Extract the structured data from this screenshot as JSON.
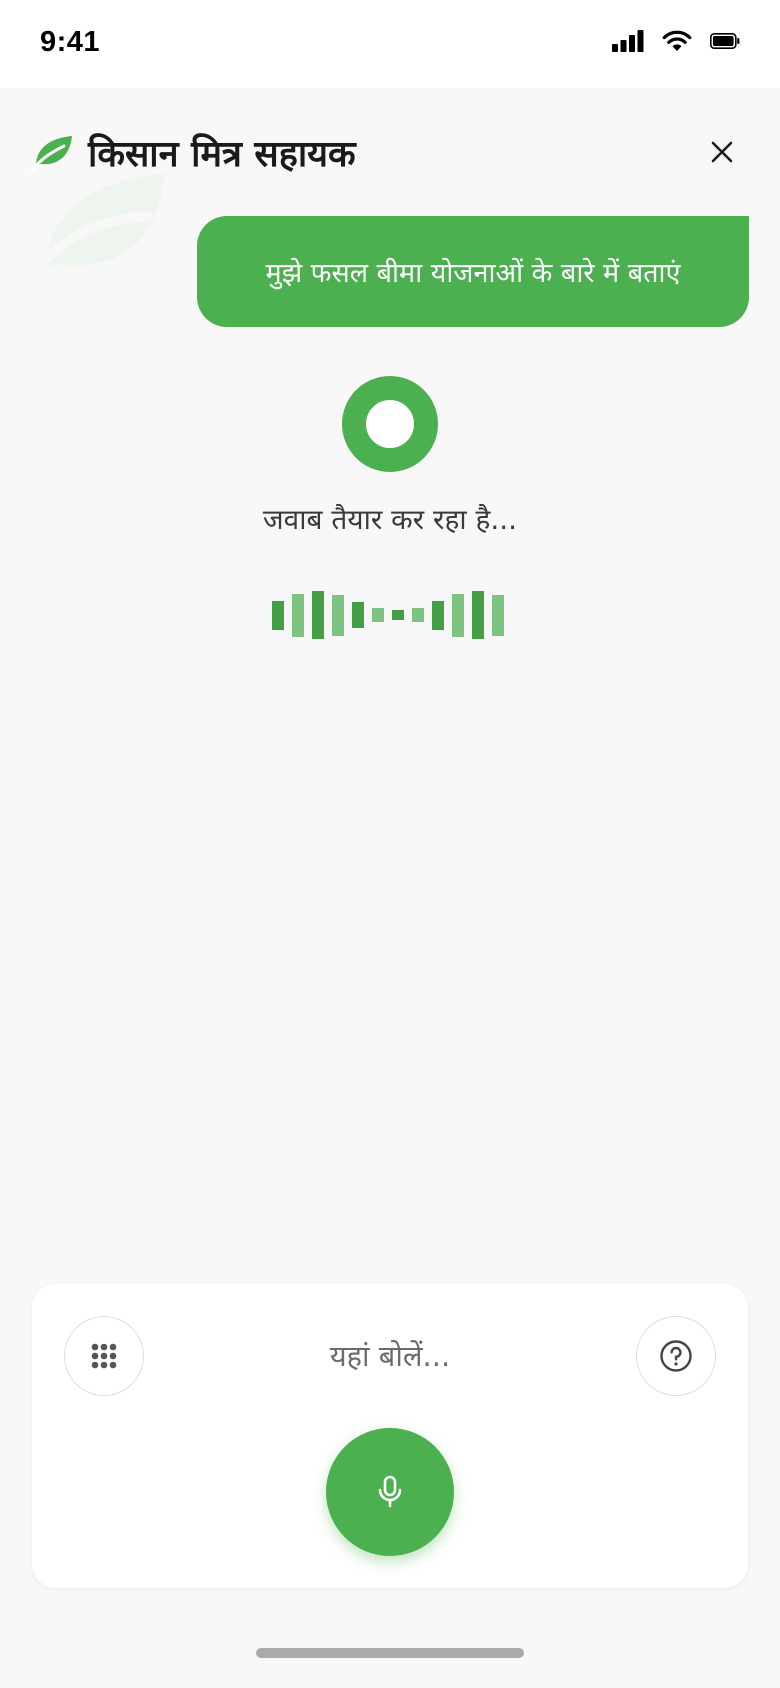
{
  "status_bar": {
    "time": "9:41",
    "icons": [
      "signal-icon",
      "wifi-icon",
      "battery-icon"
    ]
  },
  "header": {
    "title": "किसान मित्र सहायक",
    "logo_icon": "leaf-icon",
    "close_icon": "close-icon"
  },
  "conversation": {
    "user_message": "मुझे फसल बीमा योजनाओं के बारे में बताएं"
  },
  "status": {
    "thinking_text": "जवाब तैयार कर रहा है...",
    "wave_levels": [
      0.6,
      0.9,
      1.0,
      0.85,
      0.55,
      0.3,
      0.2,
      0.3,
      0.6,
      0.9,
      1.0,
      0.85
    ]
  },
  "input": {
    "placeholder": "यहां बोलें...",
    "keypad_icon": "keypad-icon",
    "help_icon": "help-icon",
    "mic_icon": "microphone-icon"
  },
  "colors": {
    "accent": "#4caf50",
    "accent_light": "#7cc47f",
    "accent_dark": "#43a047",
    "background": "#f8f8f8"
  }
}
